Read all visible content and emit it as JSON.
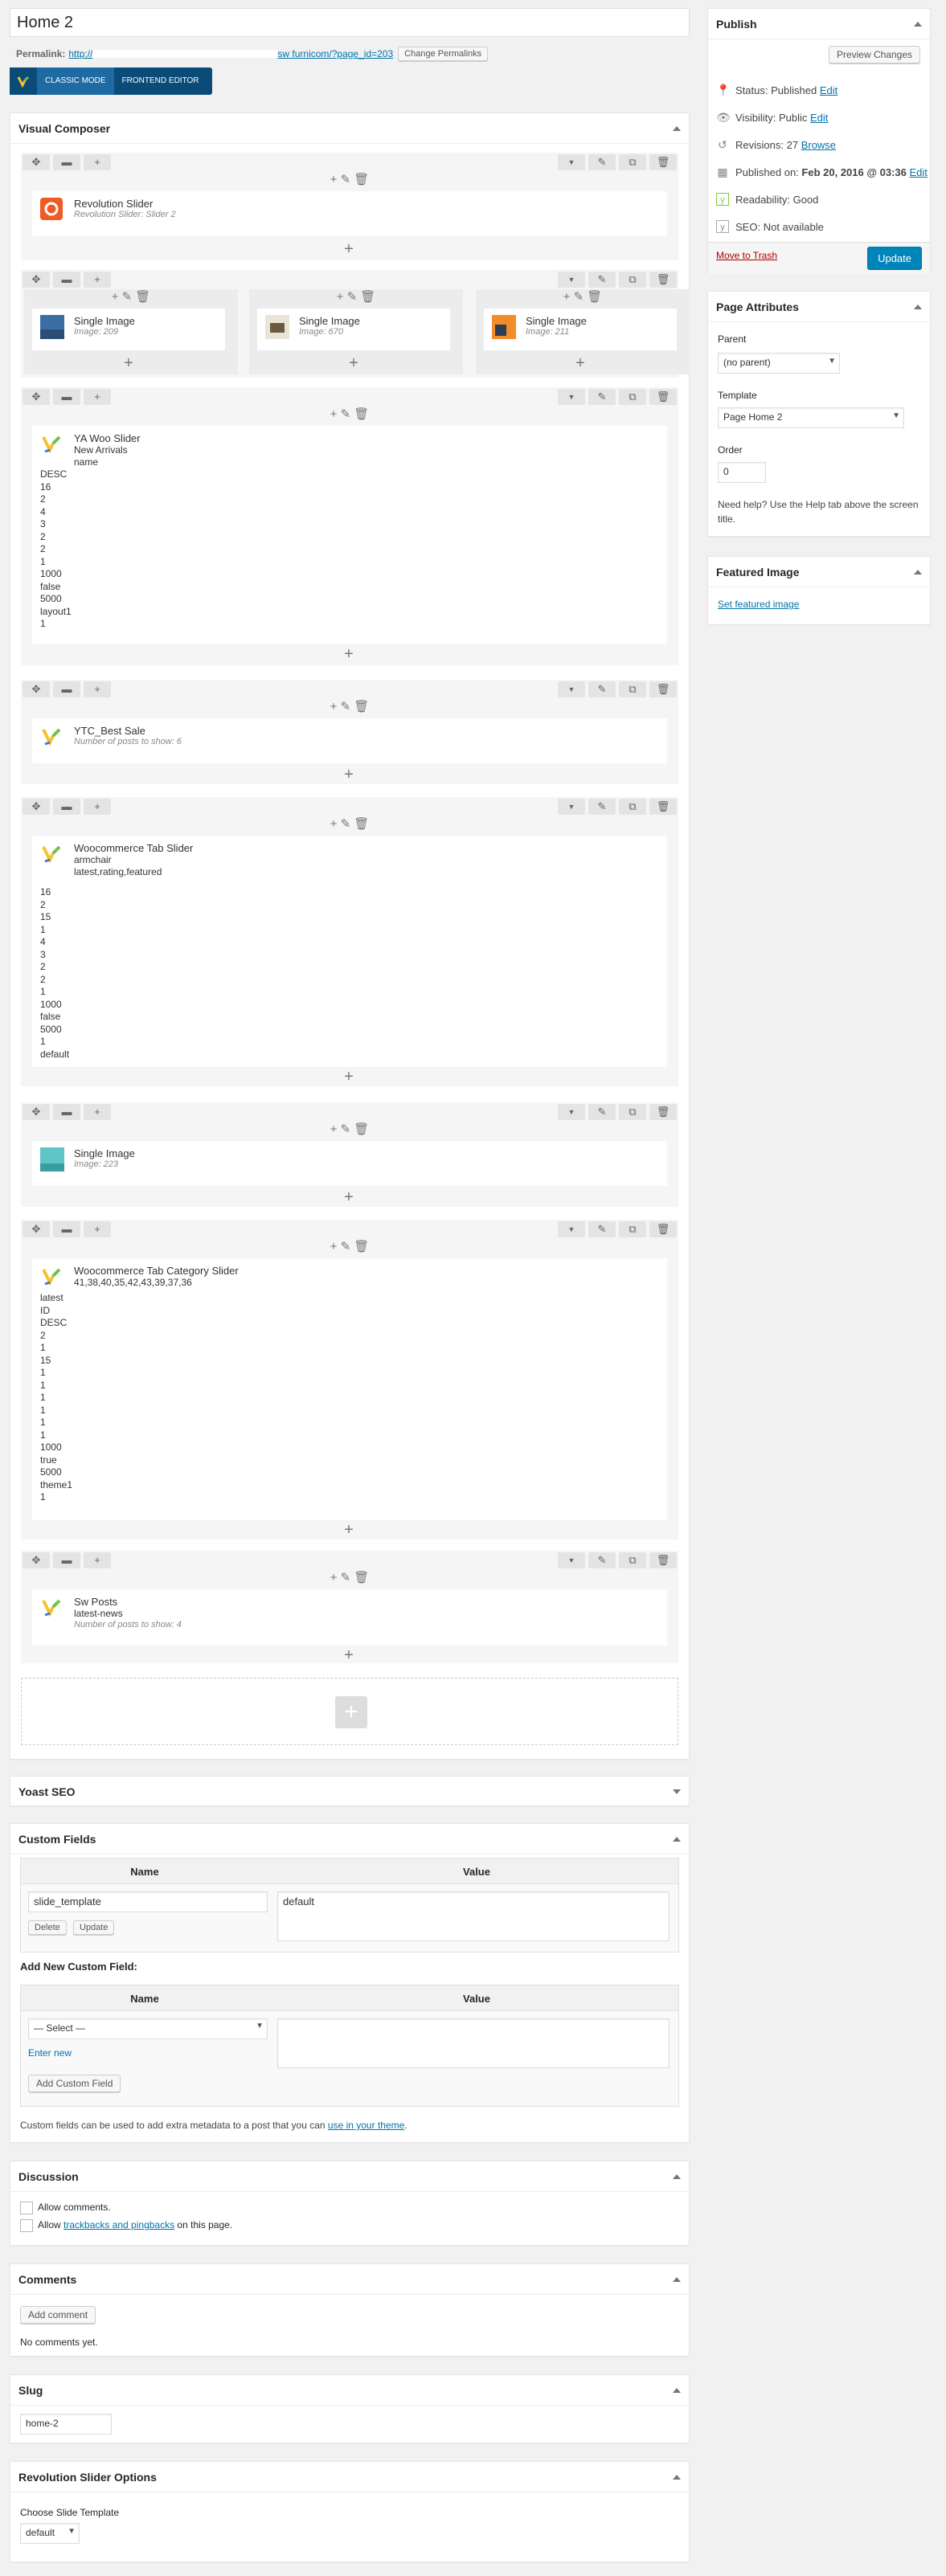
{
  "title": "Home 2",
  "permalink": {
    "label": "Permalink:",
    "url_start": "http://",
    "url_end": "sw furnicom/?page_id=203",
    "change_btn": "Change Permalinks"
  },
  "editor_modes": {
    "classic": "CLASSIC MODE",
    "frontend": "FRONTEND EDITOR"
  },
  "vc": {
    "title": "Visual Composer",
    "rev": {
      "name": "Revolution Slider",
      "sub": "Revolution Slider: Slider 2"
    },
    "images": [
      {
        "name": "Single Image",
        "sub": "Image: 209"
      },
      {
        "name": "Single Image",
        "sub": "Image: 670"
      },
      {
        "name": "Single Image",
        "sub": "Image: 211"
      }
    ],
    "woo": {
      "name": "YA Woo Slider",
      "line1": "New Arrivals",
      "line2": "name",
      "params": "DESC\n16\n2\n4\n3\n2\n2\n1\n1000\nfalse\n5000\nlayout1\n1"
    },
    "best": {
      "name": "YTC_Best Sale",
      "sub": "Number of posts to show: 6"
    },
    "tab": {
      "name": "Woocommerce Tab Slider",
      "line1": "armchair",
      "line2": "latest,rating,featured",
      "params": "16\n2\n15\n1\n4\n3\n2\n2\n1\n1000\nfalse\n5000\n1\ndefault"
    },
    "img2": {
      "name": "Single Image",
      "sub": "Image: 223"
    },
    "cat": {
      "name": "Woocommerce Tab Category Slider",
      "line1": "41,38,40,35,42,43,39,37,36",
      "params": "latest\nID\nDESC\n2\n1\n15\n1\n1\n1\n1\n1\n1\n1000\ntrue\n5000\ntheme1\n1"
    },
    "posts": {
      "name": "Sw Posts",
      "line1": "latest-news",
      "sub": "Number of posts to show: 4"
    }
  },
  "yoast": {
    "title": "Yoast SEO"
  },
  "custom_fields": {
    "title": "Custom Fields",
    "col_name": "Name",
    "col_value": "Value",
    "name_value": "slide_template",
    "value_value": "default",
    "delete": "Delete",
    "update": "Update",
    "add_new": "Add New Custom Field:",
    "select": "— Select —",
    "enter_new": "Enter new",
    "add_btn": "Add Custom Field",
    "note_pre": "Custom fields can be used to add extra metadata to a post that you can ",
    "note_link": "use in your theme",
    "note_post": "."
  },
  "discussion": {
    "title": "Discussion",
    "allow_comments": "Allow comments.",
    "allow_pre": "Allow ",
    "allow_link": "trackbacks and pingbacks",
    "allow_post": " on this page."
  },
  "comments": {
    "title": "Comments",
    "add": "Add comment",
    "none": "No comments yet."
  },
  "slug": {
    "title": "Slug",
    "value": "home-2"
  },
  "revslider": {
    "title": "Revolution Slider Options",
    "label": "Choose Slide Template",
    "value": "default"
  },
  "publish": {
    "title": "Publish",
    "preview": "Preview Changes",
    "status_label": "Status:",
    "status": "Published",
    "visibility_label": "Visibility:",
    "visibility": "Public",
    "revisions_label": "Revisions:",
    "revisions": "27",
    "browse": "Browse",
    "published_label": "Published on:",
    "published": "Feb 20, 2016 @ 03:36",
    "edit": "Edit",
    "readability_label": "Readability:",
    "readability": "Good",
    "seo_label": "SEO:",
    "seo": "Not available",
    "trash": "Move to Trash",
    "update": "Update"
  },
  "page_attributes": {
    "title": "Page Attributes",
    "parent_label": "Parent",
    "parent": "(no parent)",
    "template_label": "Template",
    "template": "Page Home 2",
    "order_label": "Order",
    "order": "0",
    "help": "Need help? Use the Help tab above the screen title."
  },
  "featured": {
    "title": "Featured Image",
    "link": "Set featured image"
  },
  "colors": {
    "accent": "#0085ba",
    "vc_dark": "#0a4b78"
  }
}
